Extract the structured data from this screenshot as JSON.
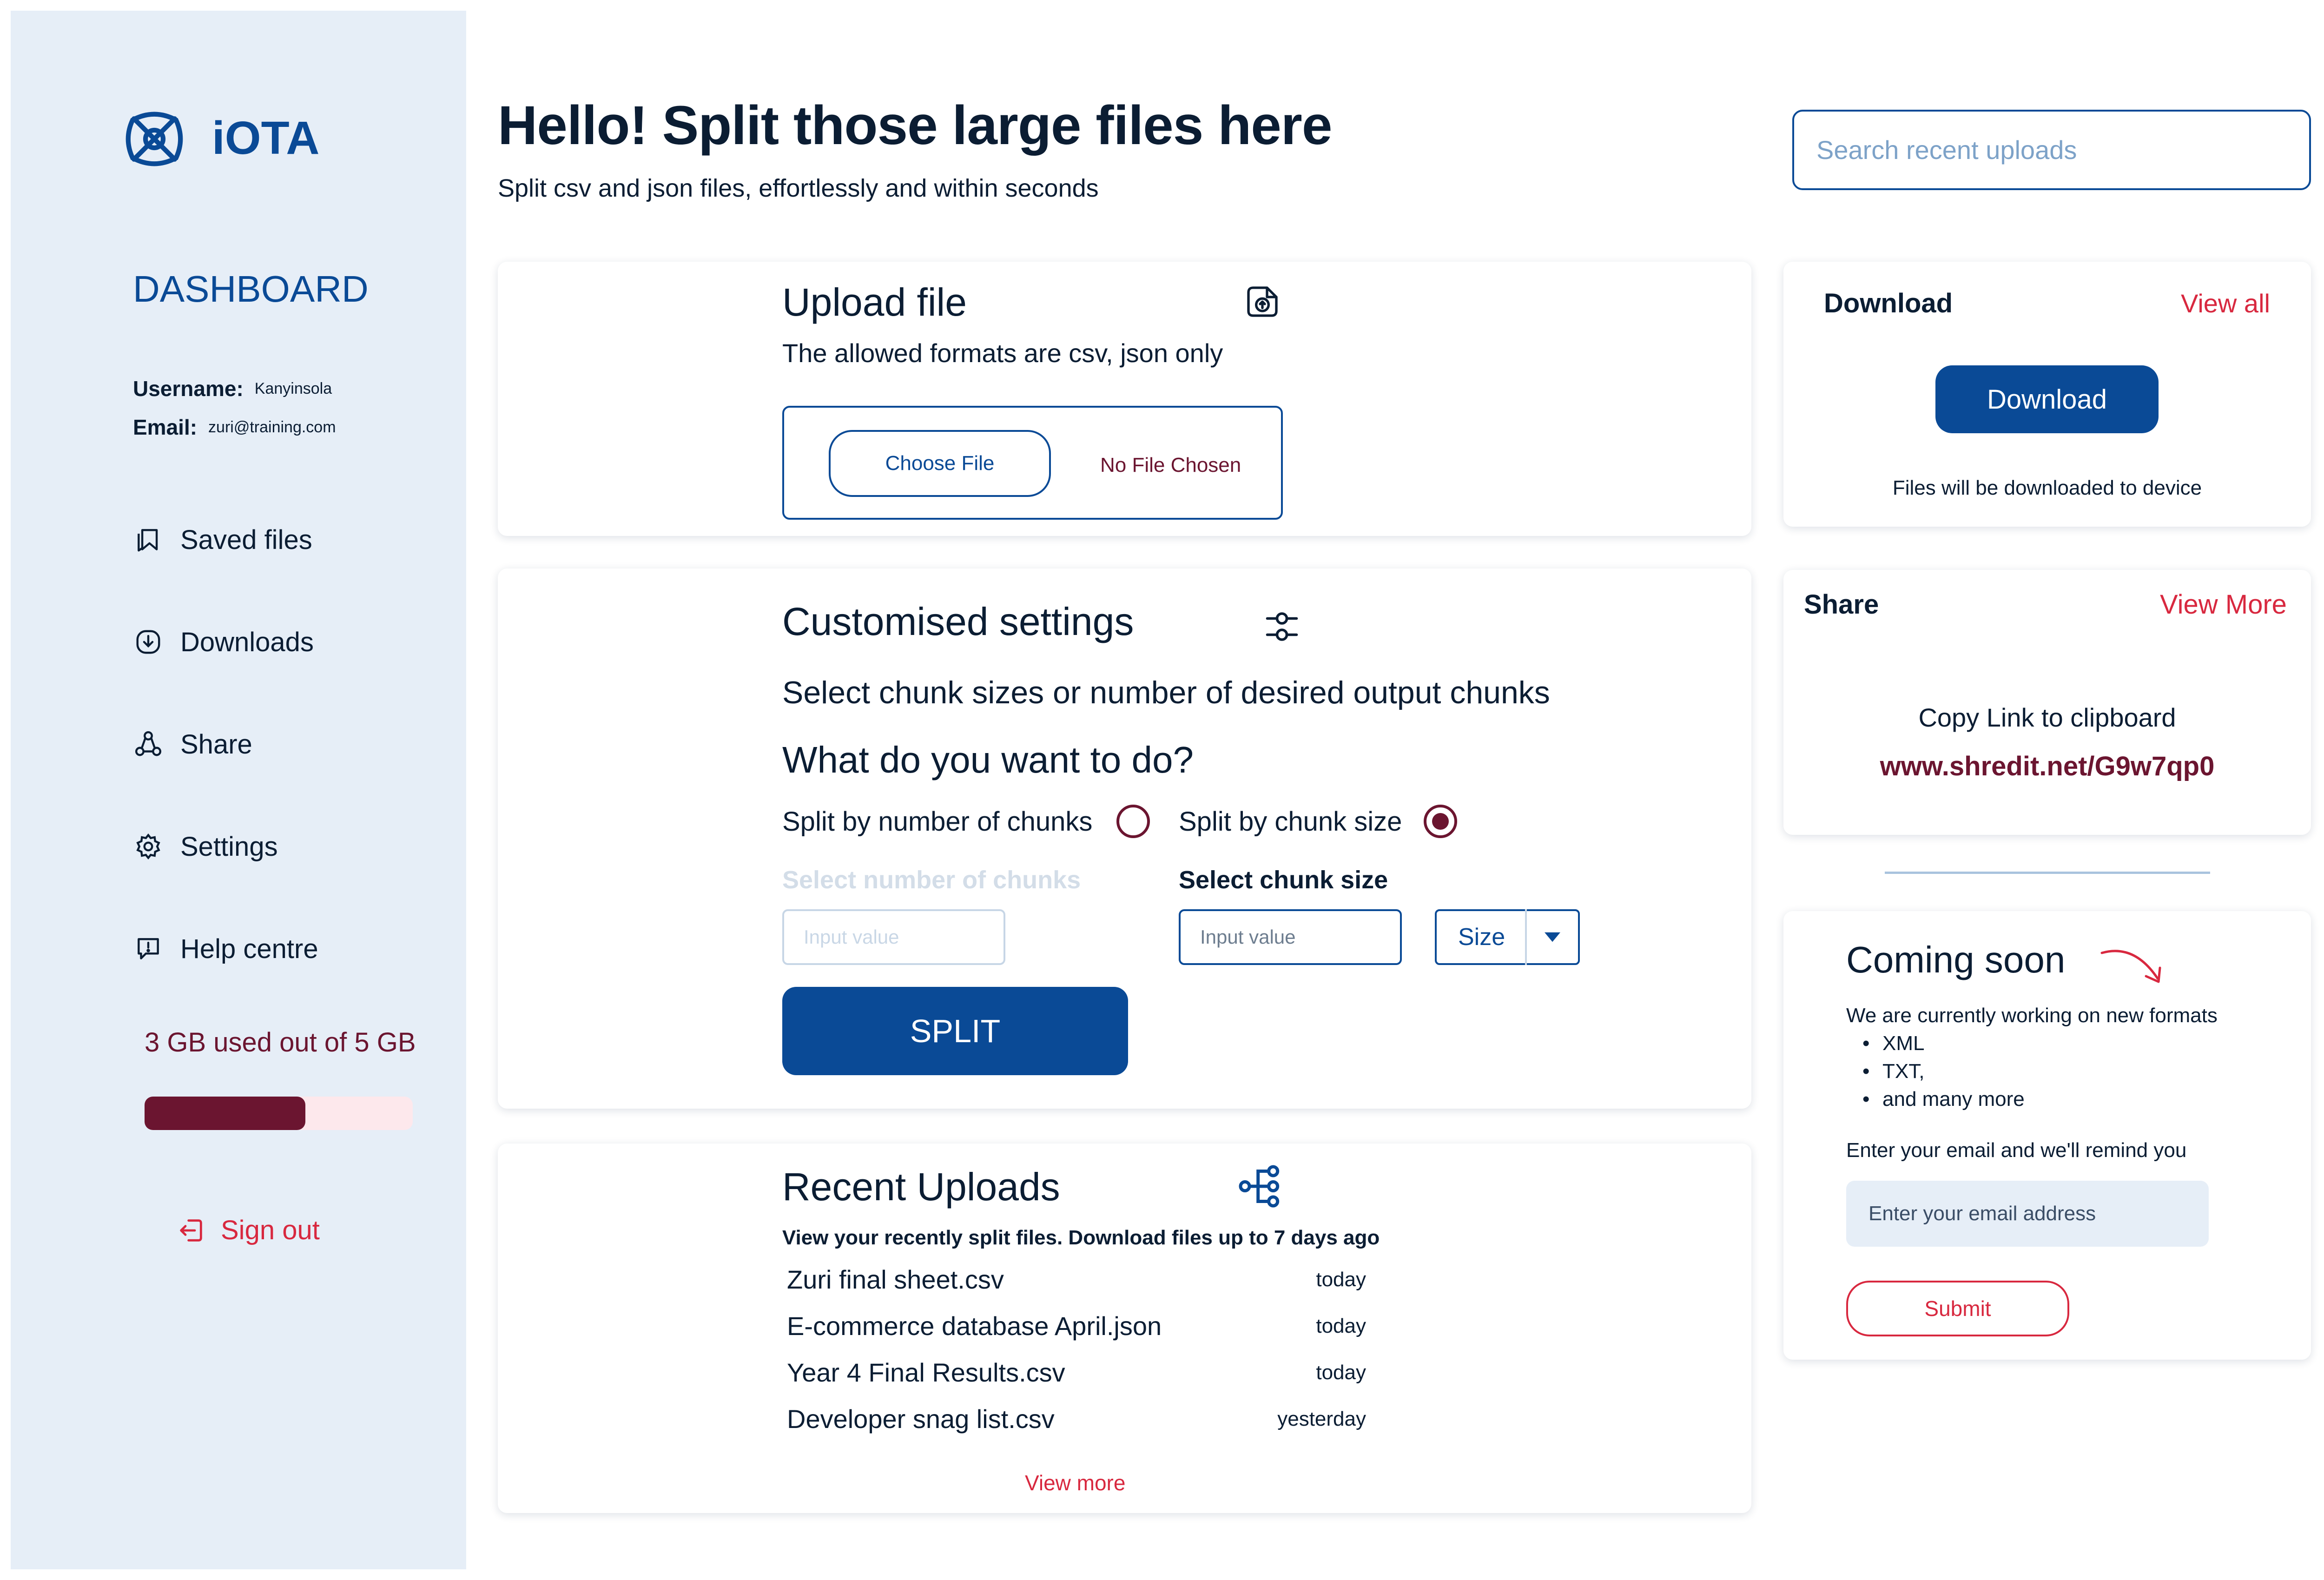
{
  "brand": {
    "name": "iOTA"
  },
  "sidebar": {
    "title": "DASHBOARD",
    "user": {
      "username_label": "Username:",
      "username": "Kanyinsola",
      "email_label": "Email:",
      "email": "zuri@training.com"
    },
    "nav": [
      {
        "label": "Saved files",
        "icon": "bookmark-icon"
      },
      {
        "label": "Downloads",
        "icon": "download-icon"
      },
      {
        "label": "Share",
        "icon": "share-icon"
      },
      {
        "label": "Settings",
        "icon": "gear-icon"
      },
      {
        "label": "Help centre",
        "icon": "help-icon"
      }
    ],
    "storage": {
      "text": "3 GB used out of 5 GB",
      "used_fraction": 0.6
    },
    "sign_out": "Sign out"
  },
  "header": {
    "title": "Hello! Split those large files here",
    "subtitle": "Split csv and json files, effortlessly and within seconds",
    "search_placeholder": "Search recent uploads"
  },
  "upload": {
    "title": "Upload file",
    "subtitle": "The allowed formats are csv, json only",
    "choose_label": "Choose File",
    "no_file": "No File Chosen"
  },
  "settings": {
    "title": "Customised settings",
    "subtitle": "Select chunk sizes or number of  desired output chunks",
    "question": "What do you want to do?",
    "option_chunks": "Split by number of chunks",
    "option_size": "Split by chunk size",
    "chunks_label": "Select number of chunks",
    "size_label": "Select chunk size",
    "chunks_placeholder": "Input value",
    "size_placeholder": "Input value",
    "size_select": "Size",
    "split_button": "SPLIT"
  },
  "recent": {
    "title": "Recent Uploads",
    "subtitle": "View your recently split files. Download files up to 7 days ago",
    "rows": [
      {
        "name": "Zuri final sheet.csv",
        "date": "today"
      },
      {
        "name": "E-commerce database April.json",
        "date": "today"
      },
      {
        "name": "Year 4 Final Results.csv",
        "date": "today"
      },
      {
        "name": "Developer snag list.csv",
        "date": "yesterday"
      }
    ],
    "view_more": "View more"
  },
  "download": {
    "title": "Download",
    "view_all": "View all",
    "button": "Download",
    "note": "Files will be downloaded to device"
  },
  "share": {
    "title": "Share",
    "view_more": "View More",
    "copy_label": "Copy Link to clipboard",
    "link": "www.shredit.net/G9w7qp0"
  },
  "coming_soon": {
    "title": "Coming soon",
    "intro": "We are currently working on new formats",
    "items": [
      "XML",
      "TXT,",
      "and many more"
    ],
    "remind": "Enter your email and we'll remind you",
    "email_placeholder": "Enter your email address",
    "submit": "Submit"
  },
  "colors": {
    "primary": "#0a4a96",
    "maroon": "#6b1530",
    "accent_red": "#d8283f",
    "sidebar_bg": "#e6eef7"
  }
}
